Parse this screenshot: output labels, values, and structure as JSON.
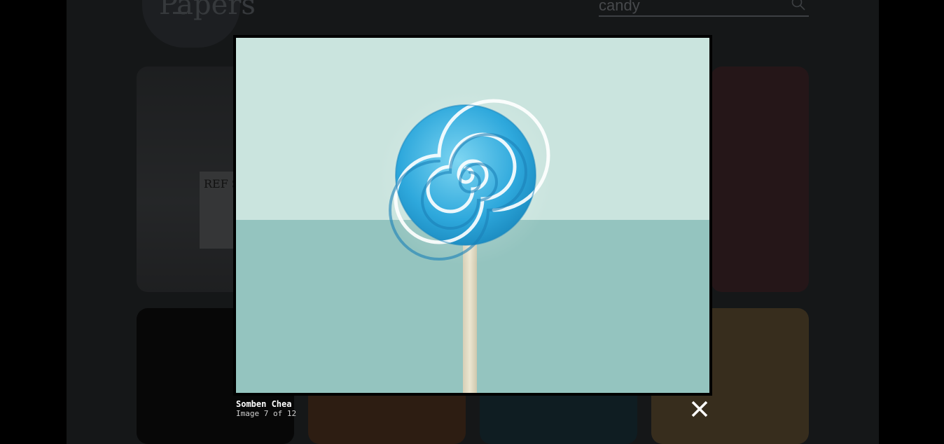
{
  "page": {
    "logo_text": "Papers",
    "search": {
      "value": "candy"
    },
    "cards": [
      {
        "text": "REF Sw"
      }
    ]
  },
  "lightbox": {
    "author": "Somben Chea",
    "counter": "Image 7 of 12",
    "image_subject": "blue swirl lollipop",
    "colors": {
      "wall": "#cae4de",
      "floor": "#94c4bf",
      "stick": "#e6dfc8",
      "candy": "#3ab4e4"
    }
  }
}
